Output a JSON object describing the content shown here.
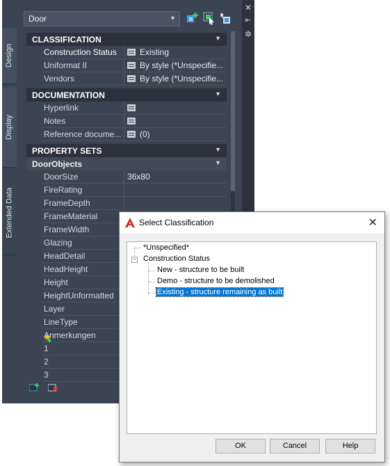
{
  "palette": {
    "tabs": [
      "Design",
      "Display",
      "Extended Data"
    ],
    "object_type": "Door",
    "sections": {
      "classification": {
        "title": "CLASSIFICATION",
        "rows": [
          {
            "label": "Construction Status",
            "value": "Existing"
          },
          {
            "label": "Uniformat II",
            "value": "By style (*Unspecifie..."
          },
          {
            "label": "Vendors",
            "value": "By style (*Unspecifie..."
          }
        ]
      },
      "documentation": {
        "title": "DOCUMENTATION",
        "rows": [
          {
            "label": "Hyperlink",
            "value": ""
          },
          {
            "label": "Notes",
            "value": ""
          },
          {
            "label": "Reference docume...",
            "value": "(0)"
          }
        ]
      },
      "property_sets": {
        "title": "PROPERTY SETS",
        "subtitle": "DoorObjects",
        "rows": [
          {
            "label": "DoorSize",
            "value": "36x80"
          },
          {
            "label": "FireRating",
            "value": ""
          },
          {
            "label": "FrameDepth",
            "value": ""
          },
          {
            "label": "FrameMaterial",
            "value": ""
          },
          {
            "label": "FrameWidth",
            "value": ""
          },
          {
            "label": "Glazing",
            "value": ""
          },
          {
            "label": "HeadDetail",
            "value": ""
          },
          {
            "label": "HeadHeight",
            "value": ""
          },
          {
            "label": "Height",
            "value": ""
          },
          {
            "label": "HeightUnformatted",
            "value": ""
          },
          {
            "label": "Layer",
            "value": ""
          },
          {
            "label": "LineType",
            "value": ""
          },
          {
            "label": "Anmerkungen",
            "value": ""
          },
          {
            "label": "1",
            "value": ""
          },
          {
            "label": "2",
            "value": ""
          },
          {
            "label": "3",
            "value": ""
          }
        ]
      }
    },
    "colors": {
      "panel_bg": "#3b4453",
      "header_bg": "#2b323d"
    }
  },
  "dialog": {
    "title": "Select Classification",
    "tree": {
      "unspecified": "*Unspecified*",
      "root": "Construction Status",
      "children": [
        "New - structure to be built",
        "Demo - structure to be demolished",
        "Existing - structure remaining as built"
      ],
      "selected": "Existing - structure remaining as built"
    },
    "buttons": {
      "ok": "OK",
      "cancel": "Cancel",
      "help": "Help"
    },
    "colors": {
      "selection": "#0078d7",
      "logo": "#d52b1e"
    }
  }
}
